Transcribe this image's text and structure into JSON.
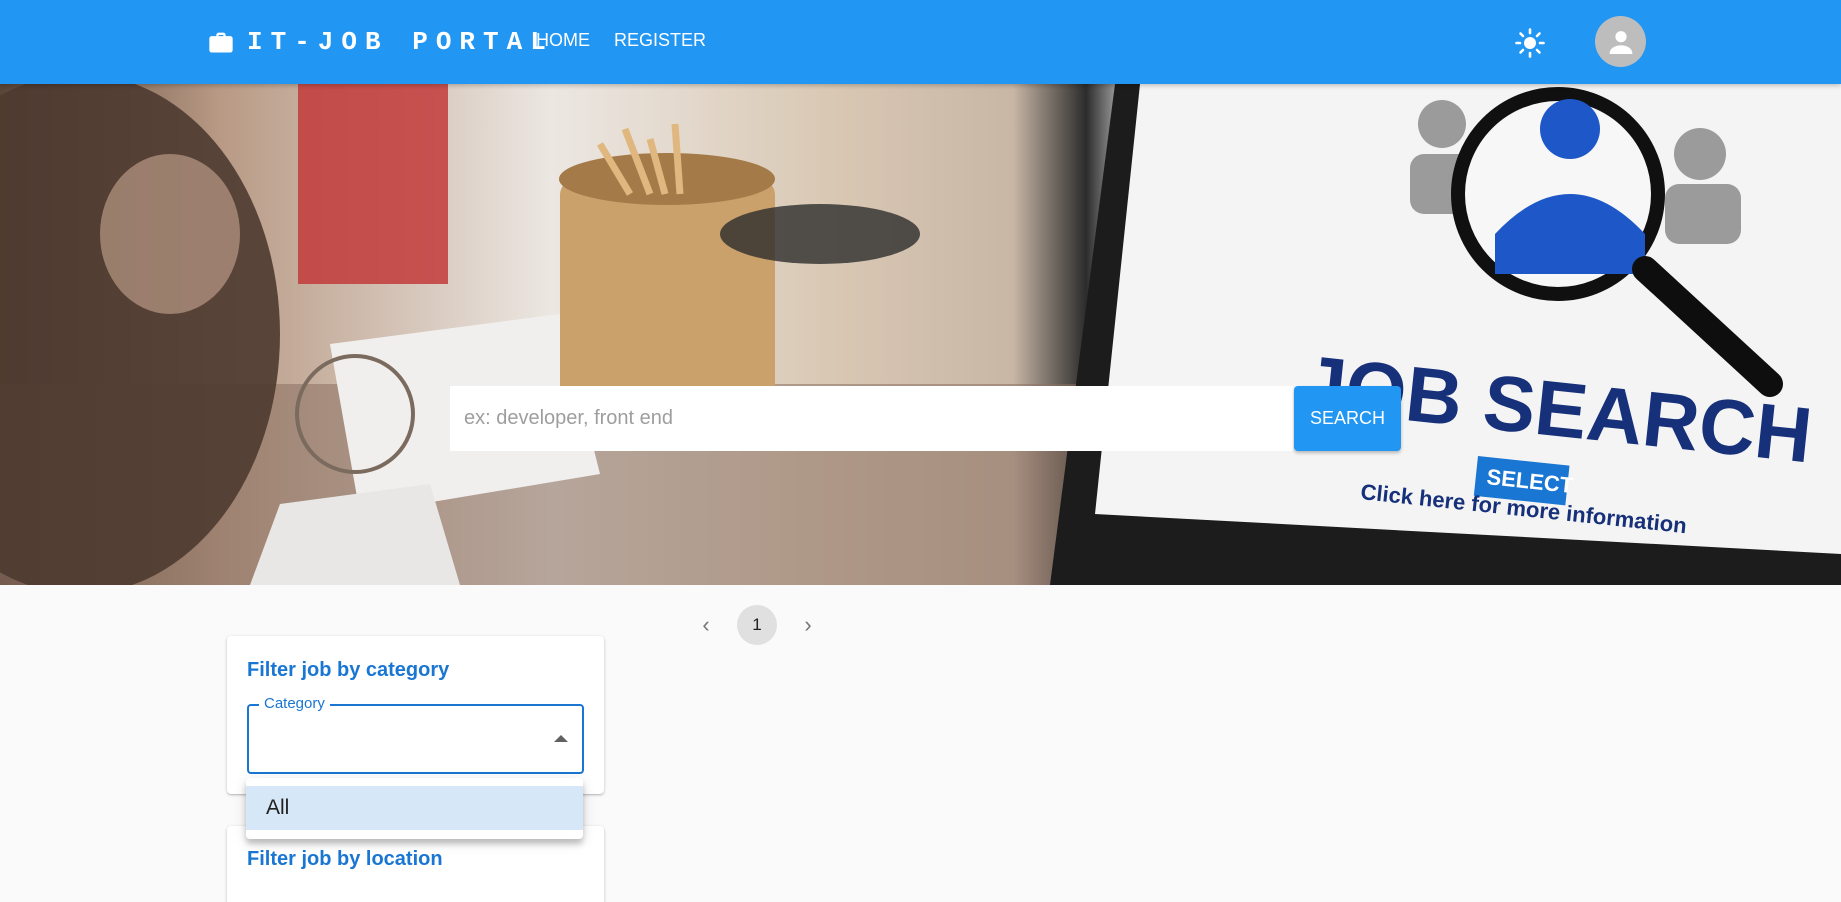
{
  "header": {
    "brand": "IT-JOB PORTAL",
    "nav": [
      "HOME",
      "REGISTER"
    ],
    "icons": {
      "brand": "briefcase-icon",
      "theme": "sun-icon",
      "avatar": "person-icon"
    },
    "color": "#2196f3"
  },
  "hero": {
    "search_placeholder": "ex: developer, front end",
    "search_value": "",
    "search_button": "SEARCH",
    "image_text": {
      "headline": "JOB SEARCH",
      "badge": "SELECT",
      "caption": "Click here for more information"
    }
  },
  "pagination": {
    "current": "1",
    "icons": {
      "prev": "chevron-left-icon",
      "next": "chevron-right-icon"
    }
  },
  "filters": {
    "category_title": "Filter job by category",
    "category_label": "Category",
    "category_value": "",
    "category_options": [
      "All"
    ],
    "location_title": "Filter job by location"
  }
}
